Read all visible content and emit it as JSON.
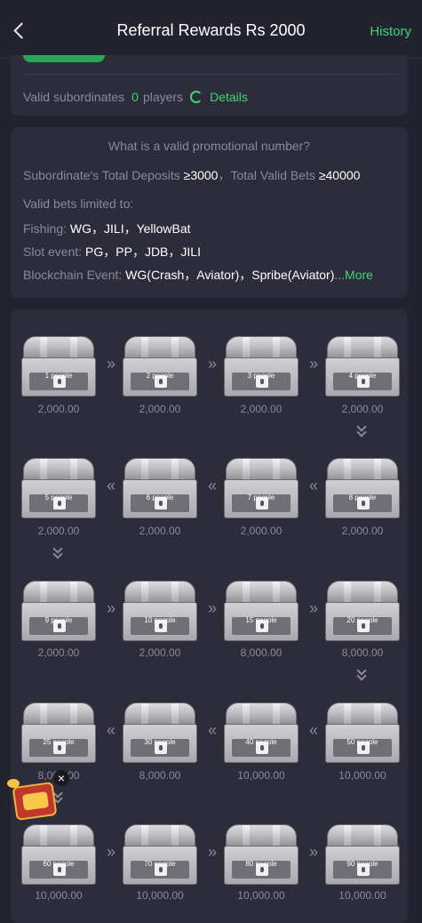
{
  "header": {
    "title": "Referral Rewards Rs 2000",
    "history": "History"
  },
  "subordinates": {
    "label": "Valid subordinates",
    "count": "0",
    "unit": "players",
    "details": "Details"
  },
  "rules": {
    "question": "What is a valid promotional number?",
    "requirement": "Subordinate's Total Deposits ≥3000，Total Valid Bets ≥40000",
    "req_prefix": "Subordinate's Total Deposits ",
    "req_deposit": "≥3000",
    "req_mid": "，Total Valid Bets ",
    "req_bets": "≥40000",
    "limited": "Valid bets limited to:",
    "fishing_label": "Fishing: ",
    "fishing_value": "WG，JILI，YellowBat",
    "slot_label": "Slot event: ",
    "slot_value": "PG，PP，JDB，JILI",
    "chain_label": "Blockchain Event: ",
    "chain_value": "WG(Crash，Aviator)，Spribe(Aviator)",
    "more": "...More"
  },
  "rewards": [
    {
      "people": "1 people",
      "amount": "2,000.00"
    },
    {
      "people": "2 people",
      "amount": "2,000.00"
    },
    {
      "people": "3 people",
      "amount": "2,000.00"
    },
    {
      "people": "4 people",
      "amount": "2,000.00"
    },
    {
      "people": "8 people",
      "amount": "2,000.00"
    },
    {
      "people": "7 people",
      "amount": "2,000.00"
    },
    {
      "people": "6 people",
      "amount": "2,000.00"
    },
    {
      "people": "5 people",
      "amount": "2,000.00"
    },
    {
      "people": "9 people",
      "amount": "2,000.00"
    },
    {
      "people": "10 people",
      "amount": "2,000.00"
    },
    {
      "people": "15 people",
      "amount": "8,000.00"
    },
    {
      "people": "20 people",
      "amount": "8,000.00"
    },
    {
      "people": "50 people",
      "amount": "10,000.00"
    },
    {
      "people": "40 people",
      "amount": "10,000.00"
    },
    {
      "people": "30 people",
      "amount": "8,000.00"
    },
    {
      "people": "25 people",
      "amount": "8,000.00"
    },
    {
      "people": "60 people",
      "amount": "10,000.00"
    },
    {
      "people": "70 people",
      "amount": "10,000.00"
    },
    {
      "people": "80 people",
      "amount": "10,000.00"
    },
    {
      "people": "90 people",
      "amount": "10,000.00"
    }
  ],
  "icons": {
    "back": "chevron-left-icon",
    "refresh": "refresh-icon",
    "chest": "treasure-chest-icon",
    "gift": "gift-chest-icon",
    "close": "close-icon"
  },
  "colors": {
    "accent": "#3ed679",
    "background": "#23222f",
    "card": "#2d2c3a"
  }
}
